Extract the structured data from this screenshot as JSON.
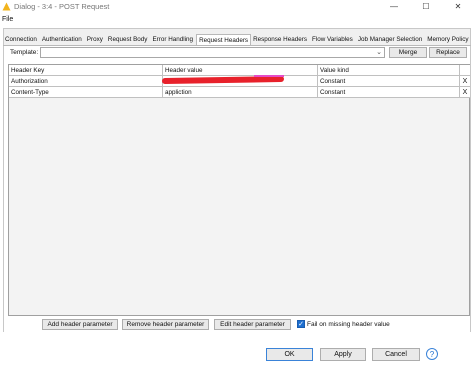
{
  "window": {
    "title": "Dialog - 3:4 - POST Request",
    "minimize_glyph": "—",
    "maximize_glyph": "☐",
    "close_glyph": "✕"
  },
  "menu": {
    "file": "File"
  },
  "tabs": [
    {
      "label": "Connection"
    },
    {
      "label": "Authentication"
    },
    {
      "label": "Proxy"
    },
    {
      "label": "Request Body"
    },
    {
      "label": "Error Handling"
    },
    {
      "label": "Request Headers",
      "active": true
    },
    {
      "label": "Response Headers"
    },
    {
      "label": "Flow Variables"
    },
    {
      "label": "Job Manager Selection"
    },
    {
      "label": "Memory Policy"
    }
  ],
  "template": {
    "label": "Template:",
    "value": "",
    "merge_label": "Merge",
    "replace_label": "Replace"
  },
  "table": {
    "columns": [
      "Header Key",
      "Header value",
      "Value kind"
    ],
    "rows": [
      {
        "key": "Authorization",
        "value": "",
        "kind": "Constant"
      },
      {
        "key": "Content-Type",
        "value": "appliction",
        "kind": "Constant"
      }
    ],
    "remove_glyph": "X"
  },
  "actions": {
    "add": "Add header parameter",
    "remove": "Remove header parameter",
    "edit": "Edit header parameter",
    "fail_on_missing": "Fail on missing header value",
    "fail_on_missing_checked": true
  },
  "footer": {
    "ok": "OK",
    "apply": "Apply",
    "cancel": "Cancel",
    "help_glyph": "?"
  },
  "colors": {
    "accent": "#1e6fd0",
    "redaction": "#e8212b"
  }
}
